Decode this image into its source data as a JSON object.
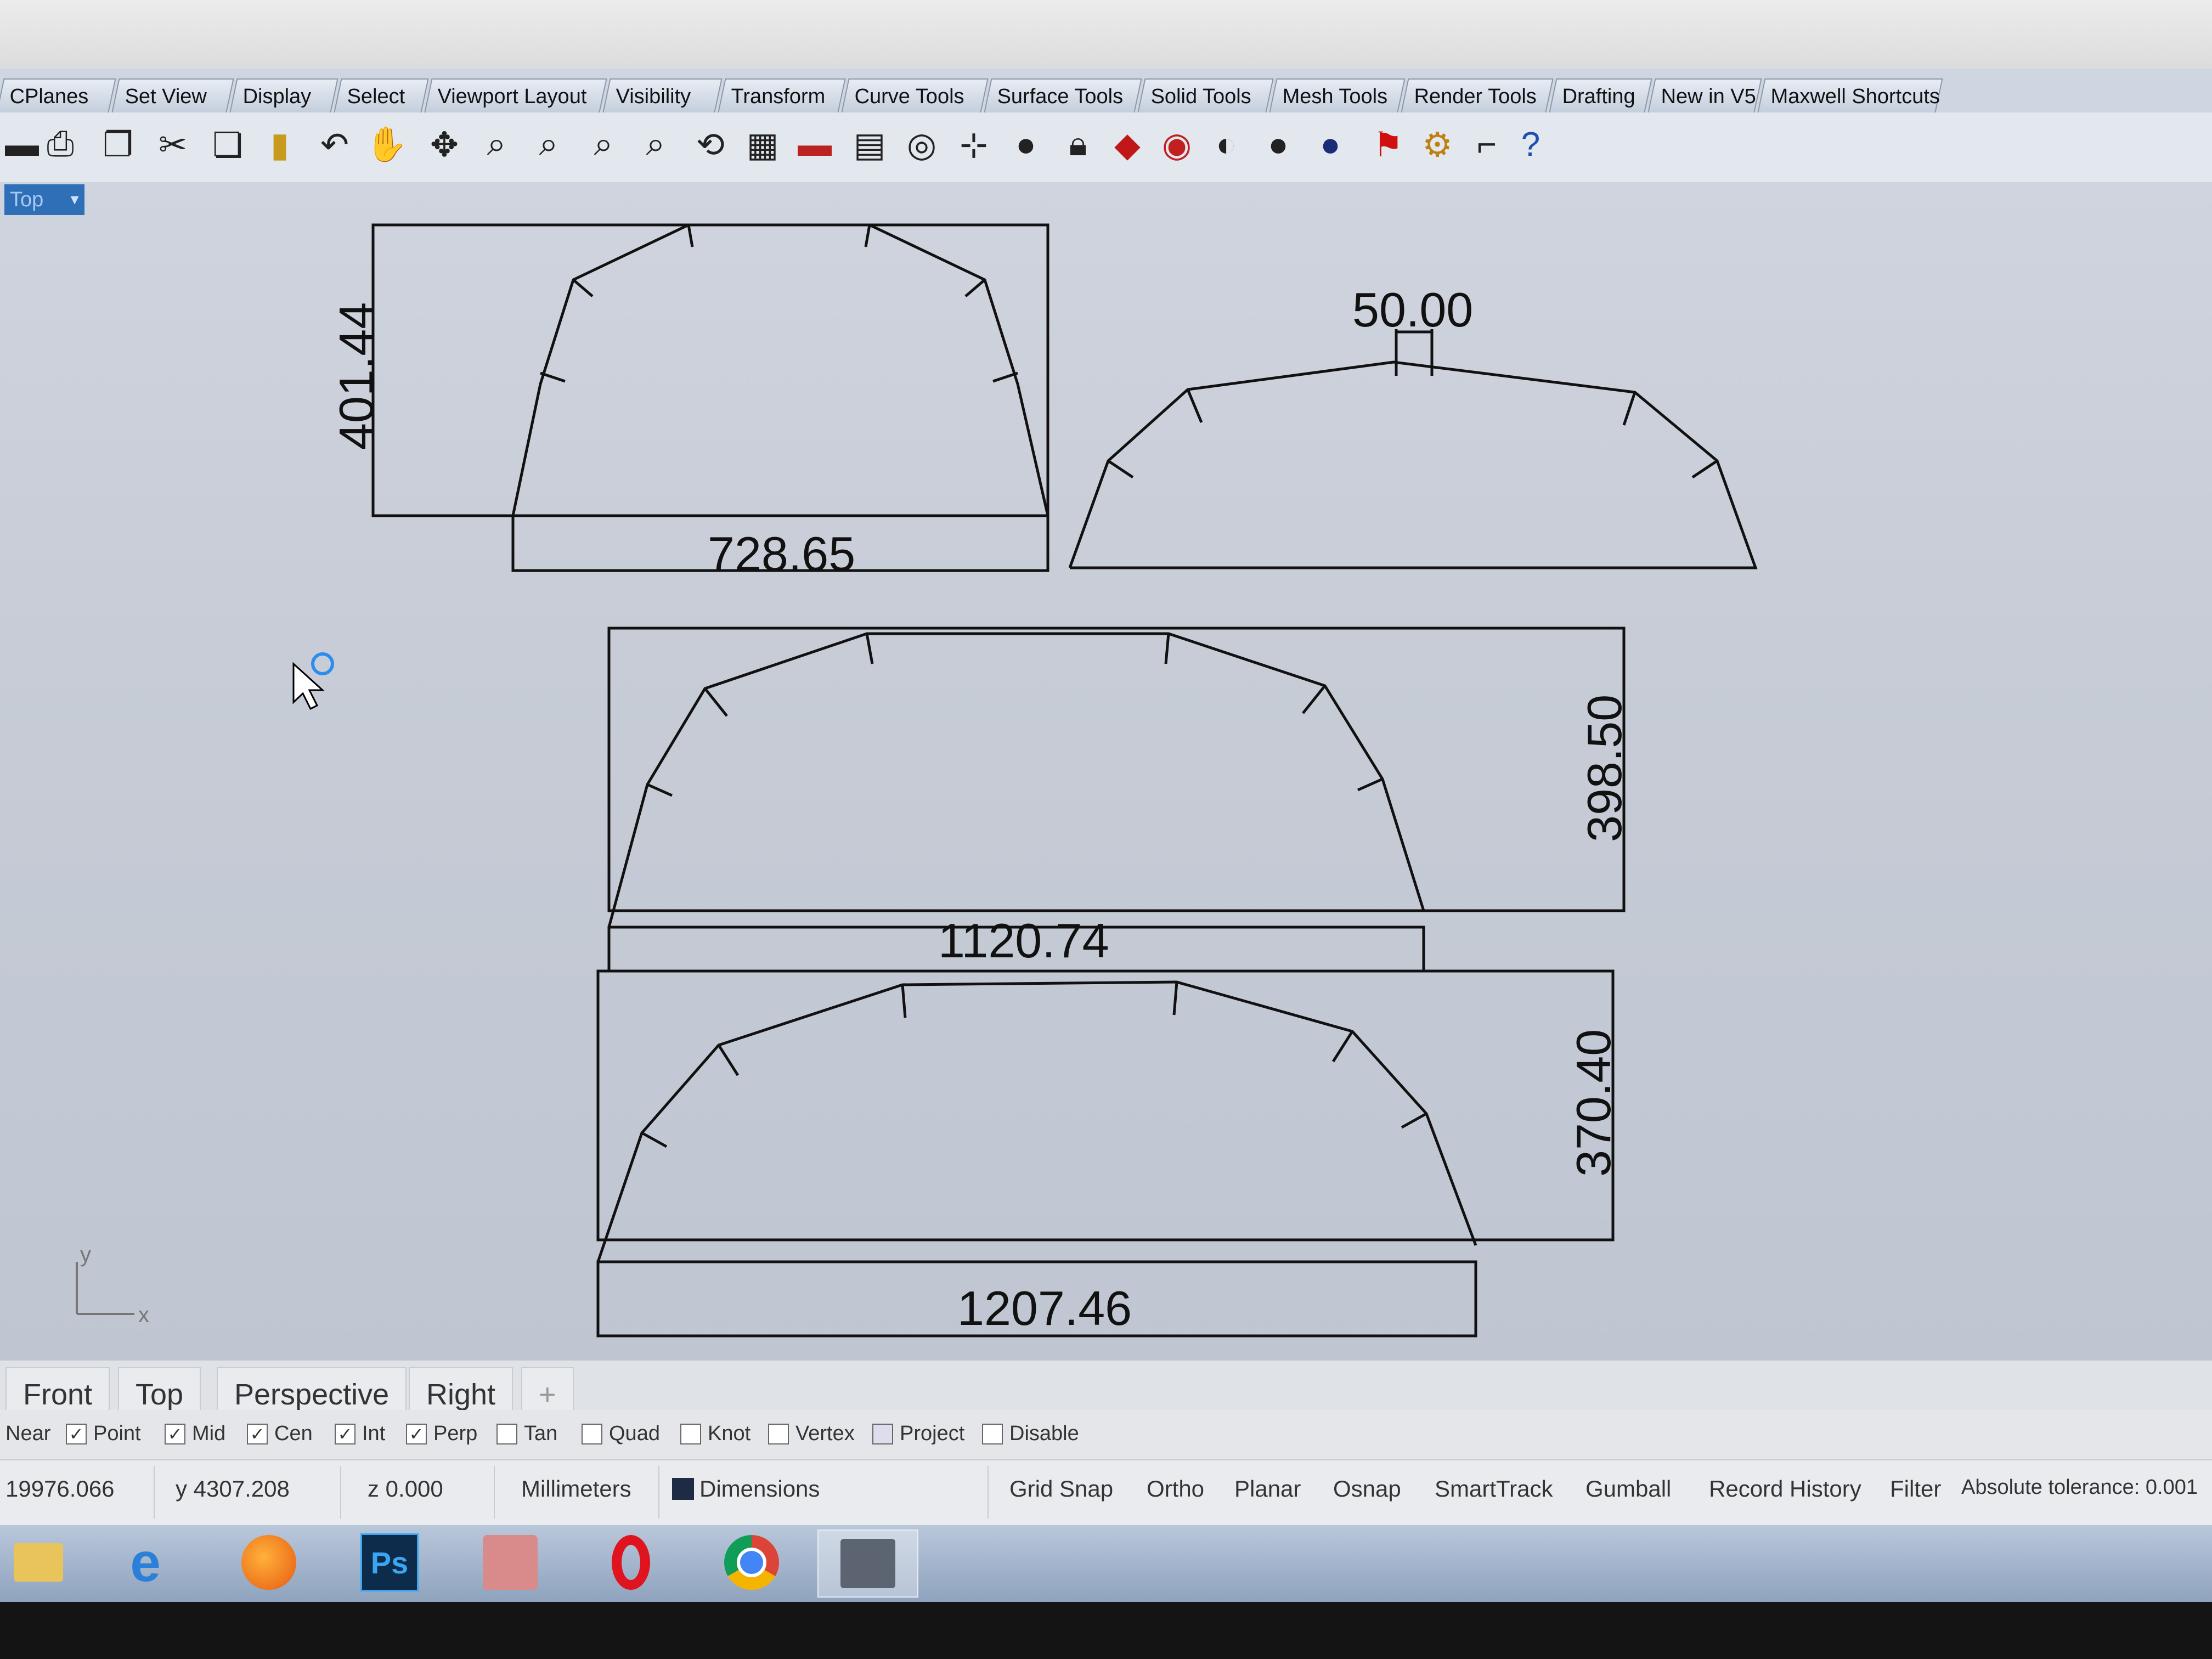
{
  "ribbon": {
    "tabs": [
      {
        "label": "CPlanes"
      },
      {
        "label": "Set View"
      },
      {
        "label": "Display"
      },
      {
        "label": "Select"
      },
      {
        "label": "Viewport Layout"
      },
      {
        "label": "Visibility"
      },
      {
        "label": "Transform"
      },
      {
        "label": "Curve Tools"
      },
      {
        "label": "Surface Tools"
      },
      {
        "label": "Solid Tools"
      },
      {
        "label": "Mesh Tools"
      },
      {
        "label": "Render Tools"
      },
      {
        "label": "Drafting"
      },
      {
        "label": "New in V5"
      },
      {
        "label": "Maxwell Shortcuts"
      }
    ]
  },
  "toolbar": {
    "icons": [
      "save-icon",
      "print-icon",
      "copy-clipboard-icon",
      "cut-icon",
      "copy-icon",
      "paste-icon",
      "undo-icon",
      "pan-hand-icon",
      "rotate-view-icon",
      "zoom-icon",
      "zoom-window-icon",
      "zoom-extents-icon",
      "zoom-selected-icon",
      "rotate-icon",
      "four-viewports-icon",
      "car-icon",
      "grid-icon",
      "circle-target-icon",
      "object-snap-icon",
      "light-bulb-icon",
      "lock-icon",
      "box-icon",
      "torus-icon",
      "sphere-shaded-icon",
      "sphere-dark-icon",
      "sphere-blue-icon",
      "flag-icon",
      "gear-icon",
      "dimension-icon",
      "help-icon"
    ]
  },
  "viewport": {
    "title": "Top",
    "axis_y": "y",
    "axis_x": "x",
    "dimensions": {
      "d1_width": "728.65",
      "d1_height": "401.44",
      "d2_top": "50.00",
      "d3_width": "1120.74",
      "d3_height": "398.50",
      "d4_width": "1207.46",
      "d4_height": "370.40"
    }
  },
  "view_tabs": {
    "front": "Front",
    "top": "Top",
    "perspective": "Perspective",
    "right": "Right",
    "add": "+"
  },
  "osnap": {
    "near": {
      "label": "Near",
      "checked": false
    },
    "point": {
      "label": "Point",
      "checked": true
    },
    "mid": {
      "label": "Mid",
      "checked": true
    },
    "cen": {
      "label": "Cen",
      "checked": true
    },
    "int": {
      "label": "Int",
      "checked": true
    },
    "perp": {
      "label": "Perp",
      "checked": true
    },
    "tan": {
      "label": "Tan",
      "checked": false
    },
    "quad": {
      "label": "Quad",
      "checked": false
    },
    "knot": {
      "label": "Knot",
      "checked": false
    },
    "vertex": {
      "label": "Vertex",
      "checked": false
    },
    "project": {
      "label": "Project",
      "checked": false
    },
    "disable": {
      "label": "Disable",
      "checked": false
    },
    "check_mark": "✓"
  },
  "status": {
    "x": "19976.066",
    "y": "y 4307.208",
    "z": "z 0.000",
    "units": "Millimeters",
    "layer": "Dimensions",
    "layer_color": "#1f2a44",
    "grid_snap": "Grid Snap",
    "ortho": "Ortho",
    "planar": "Planar",
    "osnap": "Osnap",
    "smarttrack": "SmartTrack",
    "gumball": "Gumball",
    "record_history": "Record History",
    "filter": "Filter",
    "tolerance": "Absolute tolerance: 0.001"
  },
  "taskbar": {
    "apps": [
      "file-explorer-icon",
      "internet-explorer-icon",
      "firefox-icon",
      "photoshop-icon",
      "image-viewer-icon",
      "opera-icon",
      "chrome-icon",
      "rhino-icon"
    ],
    "ps_label": "Ps"
  }
}
